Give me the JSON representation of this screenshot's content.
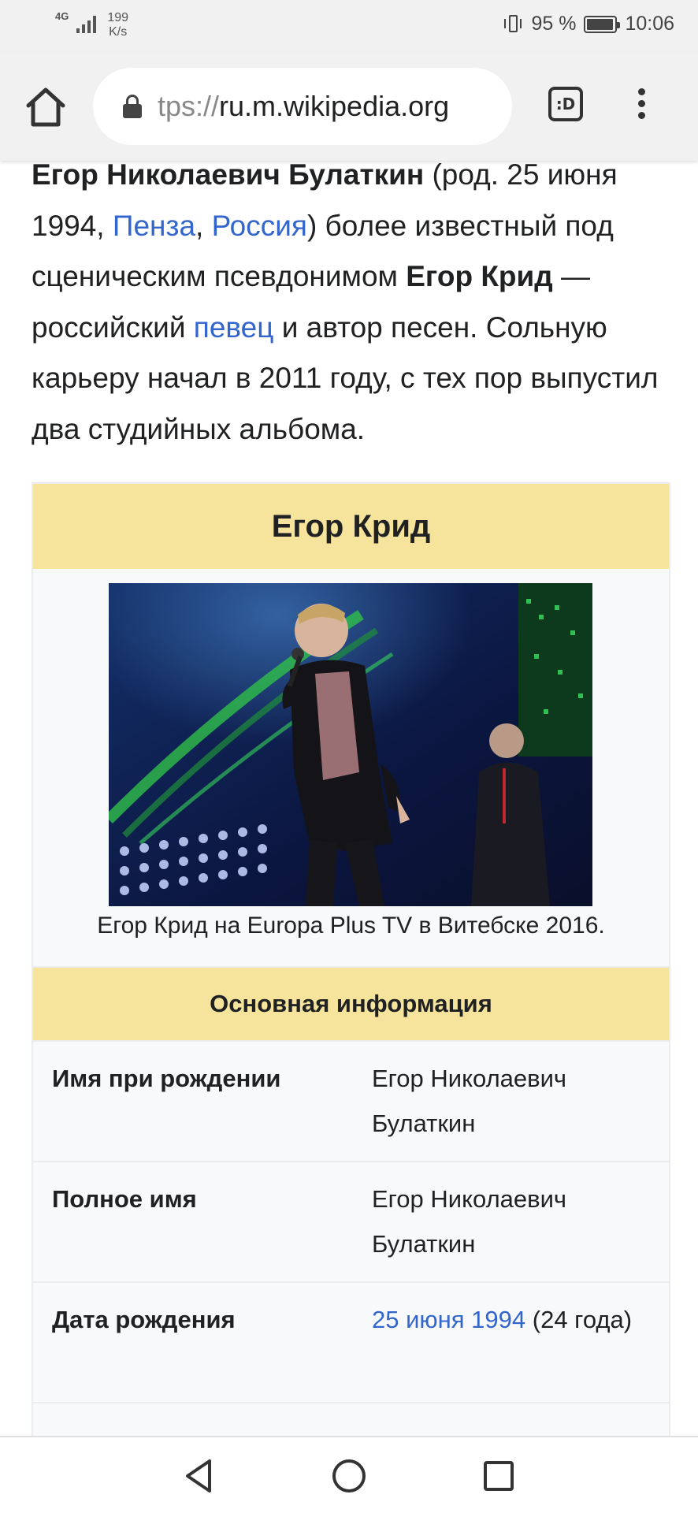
{
  "status_bar": {
    "network": "4G",
    "speed_value": "199",
    "speed_unit": "K/s",
    "battery": "95 %",
    "time": "10:06"
  },
  "browser": {
    "url_dim": "tps://",
    "url_main": "ru.m.wikipedia.org",
    "tabs_label": ":D"
  },
  "lead": {
    "name": "Егор Николаевич Булаткин",
    "text_1": " (род. 25 июня 1994, ",
    "link_penza": "Пенза",
    "comma": ", ",
    "link_russia": "Россия",
    "text_2": ") более известный под сценическим псевдонимом ",
    "pseudonym": "Егор Крид",
    "text_3": " — российский ",
    "link_singer": "певец",
    "text_4": " и автор песен. Сольную карьеру начал в 2011 году, с тех пор выпустил два студийных альбома."
  },
  "infobox": {
    "title": "Егор Крид",
    "caption": "Егор Крид на Europa Plus TV в Витебске 2016.",
    "section": "Основная информация",
    "rows": [
      {
        "label": "Имя при рождении",
        "value": "Егор Николаевич Булаткин"
      },
      {
        "label": "Полное имя",
        "value": "Егор Николаевич Булаткин"
      },
      {
        "label": "Дата рождения",
        "value_link": "25 июня 1994",
        "value_text": " (24 года)"
      }
    ]
  },
  "colors": {
    "link": "#3366cc",
    "infobox_header": "#f6e49c",
    "text": "#202122"
  }
}
